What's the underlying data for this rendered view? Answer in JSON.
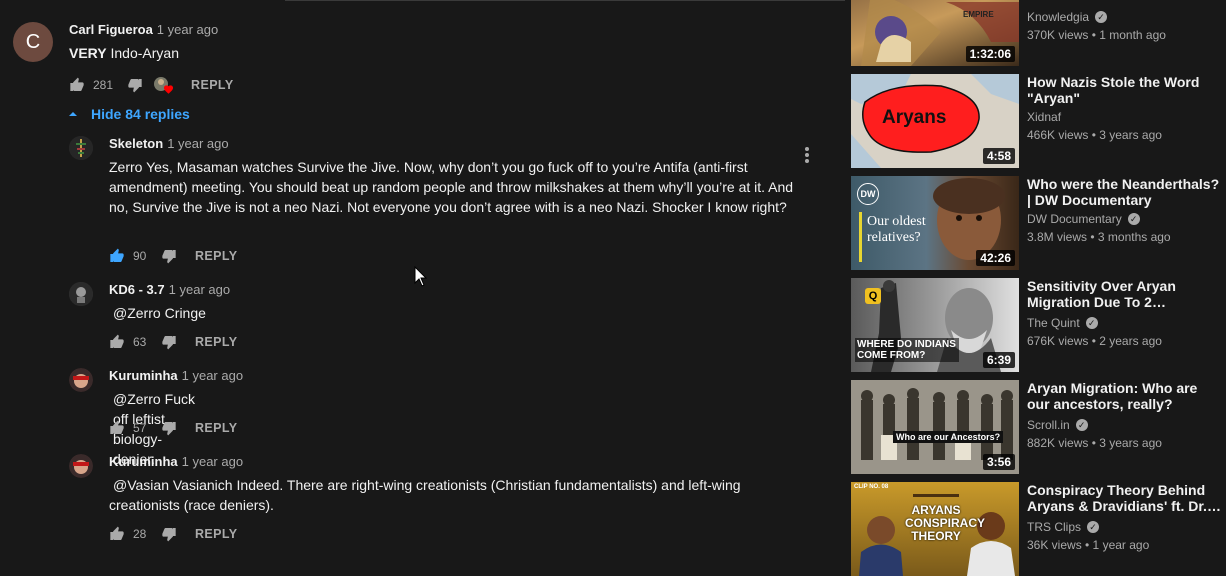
{
  "comments": {
    "top": {
      "avatar_letter": "C",
      "author": "Carl Figueroa",
      "time": "1 year ago",
      "text_bold": "VERY",
      "text": " Indo-Aryan",
      "likes": "281",
      "reply": "REPLY"
    },
    "hide_replies": "Hide 84 replies",
    "replies": [
      {
        "author": "Skeleton",
        "time": "1 year ago",
        "text": "Zerro Yes, Masaman watches Survive the Jive. Now, why don’t you go fuck off to you’re Antifa (anti-first amendment) meeting. You should beat up random people and throw milkshakes at them why’ll you’re at it. And no, Survive the Jive is not a neo Nazi. Not everyone you don’t agree with is a neo Nazi. Shocker I know right?",
        "likes": "90",
        "reply": "REPLY"
      },
      {
        "author": "KD6 - 3.7",
        "time": "1 year ago",
        "mention": "@Zerro",
        "text": "Cringe",
        "likes": "63",
        "reply": "REPLY"
      },
      {
        "author": "Kuruminha",
        "time": "1 year ago",
        "mention": "@Zerro",
        "text": "Fuck off leftist biology-denier.",
        "likes": "57",
        "reply": "REPLY"
      },
      {
        "author": "Kuruminha",
        "time": "1 year ago",
        "mention": "@Vasian Vasianich",
        "text": "Indeed. There are right-wing creationists (Christian fundamentalists) and left-wing creationists (race deniers).",
        "likes": "28",
        "reply": "REPLY"
      }
    ]
  },
  "sidebar": {
    "videos": [
      {
        "title": "",
        "channel": "Knowledgia",
        "verified": true,
        "views": "370K views • 1 month ago",
        "duration": "1:32:06",
        "thumb_text": "EMPIRE"
      },
      {
        "title": "How Nazis Stole the Word \"Aryan\"",
        "channel": "Xidnaf",
        "verified": false,
        "views": "466K views • 3 years ago",
        "duration": "4:58",
        "thumb_text": "Aryans"
      },
      {
        "title": "Who were the Neanderthals? | DW Documentary",
        "channel": "DW Documentary",
        "verified": true,
        "views": "3.8M views • 3 months ago",
        "duration": "42:26",
        "thumb_text": "Our oldest relatives?",
        "thumb_logo": "DW"
      },
      {
        "title": "Sensitivity Over Aryan Migration Due To 2…",
        "channel": "The Quint",
        "verified": true,
        "views": "676K views • 2 years ago",
        "duration": "6:39",
        "thumb_text": "WHERE DO INDIANS COME FROM?",
        "thumb_logo": "Q"
      },
      {
        "title": "Aryan Migration: Who are our ancestors, really?",
        "channel": "Scroll.in",
        "verified": true,
        "views": "882K views • 3 years ago",
        "duration": "3:56",
        "thumb_text": "Who are our Ancestors?"
      },
      {
        "title": "Conspiracy Theory Behind Aryans & Dravidians' ft. Dr.…",
        "channel": "TRS Clips",
        "verified": true,
        "views": "36K views • 1 year ago",
        "duration": "",
        "thumb_text": "ARYANS CONSPIRACY THEORY",
        "thumb_logo": "CLIP NO. 08"
      }
    ]
  }
}
